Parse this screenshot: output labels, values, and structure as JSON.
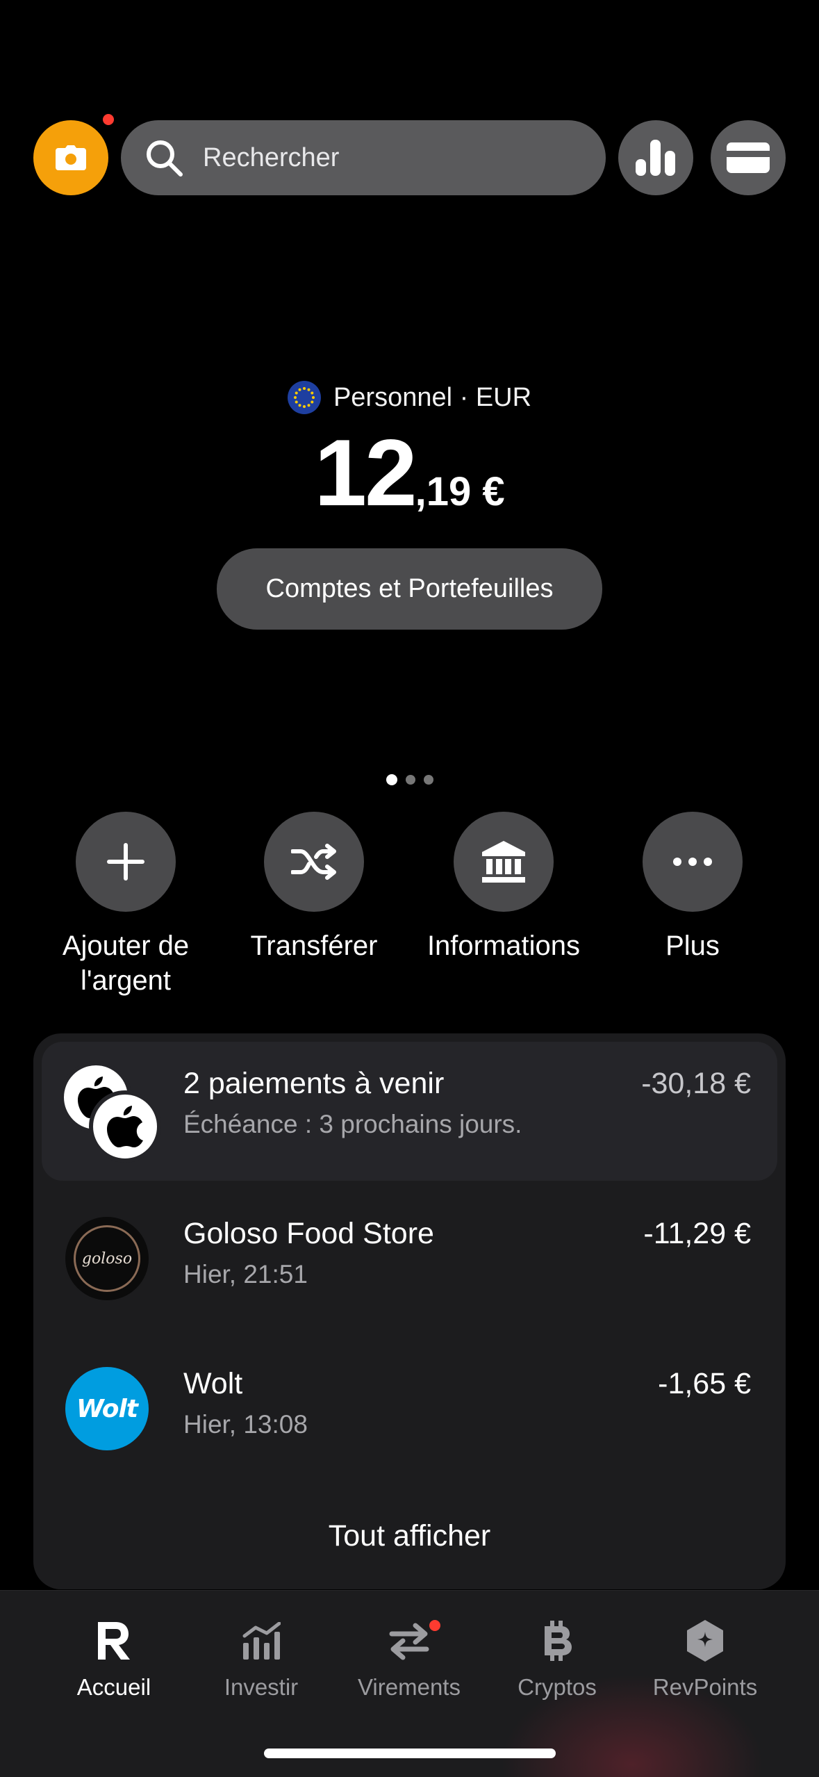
{
  "header": {
    "search_placeholder": "Rechercher",
    "camera_button_icon": "camera-icon",
    "analytics_icon": "bar-chart-icon",
    "cards_icon": "card-icon"
  },
  "account": {
    "label": "Personnel · EUR",
    "flag_icon": "eu-flag-icon",
    "balance_int": "12",
    "balance_dec": ",19 €",
    "accounts_button": "Comptes et Portefeuilles",
    "pager": {
      "pages": 3,
      "active": 1
    }
  },
  "actions": [
    {
      "label": "Ajouter de l'argent",
      "icon": "plus-icon"
    },
    {
      "label": "Transférer",
      "icon": "shuffle-icon"
    },
    {
      "label": "Informations",
      "icon": "bank-icon"
    },
    {
      "label": "Plus",
      "icon": "more-icon"
    }
  ],
  "transactions": {
    "upcoming": {
      "title": "2 paiements à venir",
      "subtitle": "Échéance : 3 prochains jours.",
      "amount": "-30,18 €"
    },
    "items": [
      {
        "title": "Goloso Food Store",
        "subtitle": "Hier, 21:51",
        "amount": "-11,29 €",
        "logo_text": "goloso"
      },
      {
        "title": "Wolt",
        "subtitle": "Hier, 13:08",
        "amount": "-1,65 €",
        "logo_text": "Wolt"
      }
    ],
    "show_all": "Tout afficher"
  },
  "nav": [
    {
      "label": "Accueil",
      "icon": "revolut-r-icon",
      "active": true
    },
    {
      "label": "Investir",
      "icon": "invest-chart-icon"
    },
    {
      "label": "Virements",
      "icon": "transfer-arrows-icon"
    },
    {
      "label": "Cryptos",
      "icon": "bitcoin-icon"
    },
    {
      "label": "RevPoints",
      "icon": "revpoints-icon"
    }
  ],
  "colors": {
    "accent": "#f5a00a",
    "notification": "#ff3b30",
    "wolt": "#009de0"
  }
}
